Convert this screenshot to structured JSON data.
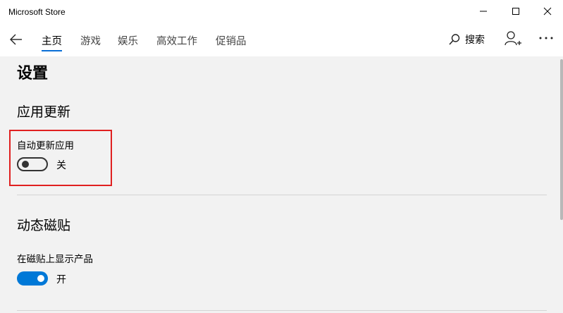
{
  "window": {
    "title": "Microsoft Store",
    "controls": [
      "minimize",
      "maximize",
      "close"
    ]
  },
  "nav": {
    "back_icon": "back-arrow-icon",
    "tabs": [
      {
        "label": "主页",
        "active": true
      },
      {
        "label": "游戏",
        "active": false
      },
      {
        "label": "娱乐",
        "active": false
      },
      {
        "label": "高效工作",
        "active": false
      },
      {
        "label": "促销品",
        "active": false
      }
    ],
    "search_label": "搜索",
    "search_icon": "search-icon",
    "account_icon": "add-account-icon",
    "more_icon": "more-icon"
  },
  "colors": {
    "accent": "#0078d7",
    "highlight_border": "#e02020",
    "background": "#f2f2f2"
  },
  "settings": {
    "page_title": "设置",
    "app_updates": {
      "section_title": "应用更新",
      "auto_update_label": "自动更新应用",
      "auto_update_state": "关",
      "auto_update_on": false
    },
    "live_tiles": {
      "section_title": "动态磁贴",
      "show_products_label": "在磁贴上显示产品",
      "show_products_state": "开",
      "show_products_on": true
    }
  }
}
